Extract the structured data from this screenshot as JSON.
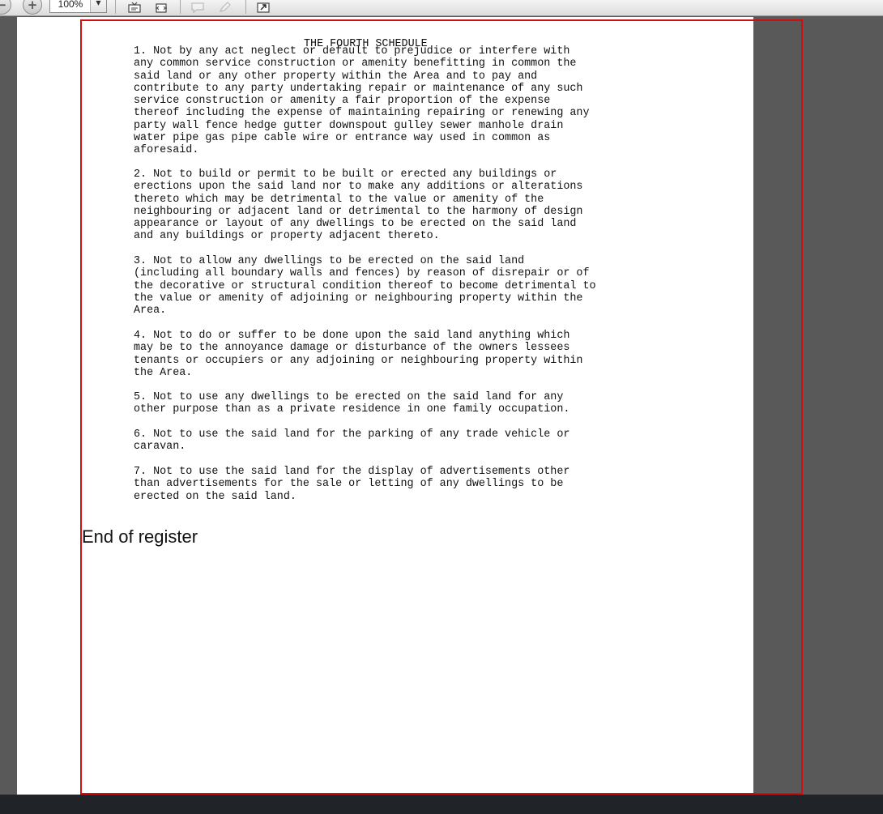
{
  "toolbar": {
    "zoom_value": "100%",
    "icons": [
      "zoom-out-icon",
      "zoom-in-icon",
      "fit-page-icon",
      "fit-width-icon",
      "comment-icon",
      "markup-icon",
      "expand-icon"
    ]
  },
  "document": {
    "schedule_title": "THE FOURTH SCHEDULE",
    "clauses": [
      "1.  Not by any act neglect or default to prejudice or interfere with\nany common service construction or amenity benefitting in common the\nsaid land or any other property within the Area and to pay and\ncontribute to any party undertaking repair or maintenance of any such\nservice construction or amenity a fair proportion of the expense\nthereof including the expense of maintaining repairing or renewing any\nparty wall fence hedge gutter downspout gulley sewer manhole drain\nwater pipe gas pipe cable wire or entrance way used in common as\naforesaid.",
      "2.  Not to build or permit to be built or erected any buildings or\nerections upon the said land nor to make any additions or alterations\nthereto which may be detrimental to the value or amenity of the\nneighbouring or adjacent land or detrimental to the harmony of design\nappearance or layout of any dwellings to be erected on the said land\nand any buildings or property adjacent thereto.",
      "3.  Not to allow any dwellings to be erected on the said land\n(including all boundary walls and fences) by reason of disrepair or of\nthe decorative or structural condition thereof to become detrimental to\nthe value or amenity of adjoining or neighbouring property within the\nArea.",
      "4.  Not to do or suffer to be done upon the said land anything which\nmay be to the annoyance damage or disturbance of the owners lessees\ntenants or occupiers or any adjoining or neighbouring property within\nthe Area.",
      "5.  Not to use any dwellings to be erected on the said land for any\nother purpose than as a private residence in one family occupation.",
      "6.  Not to use the said land for the parking of any trade vehicle or\ncaravan.",
      "7.  Not to use the said land for the display of advertisements other\nthan advertisements for the sale or letting of any dwellings to be\nerected on the said land."
    ],
    "end_text": "End of register"
  },
  "colors": {
    "frame": "#d01010",
    "viewer_background": "#595959",
    "page": "#ffffff"
  }
}
